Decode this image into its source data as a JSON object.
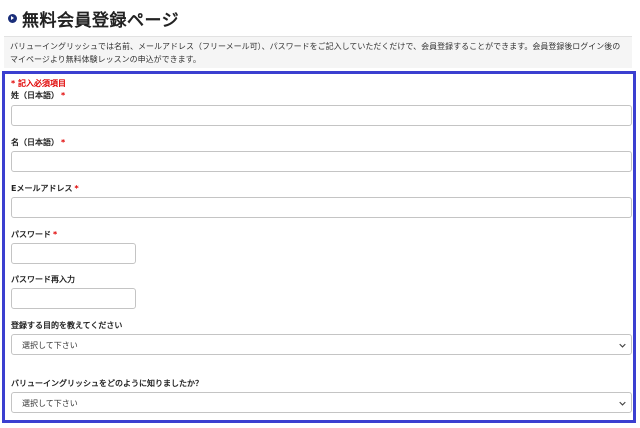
{
  "page": {
    "title": "無料会員登録ページ",
    "intro": "バリューイングリッシュでは名前、メールアドレス（フリーメール可）、パスワードをご記入していただくだけで、会員登録することができます。会員登録後ログイン後のマイページより無料体験レッスンの申込ができます。"
  },
  "form": {
    "required_note": "* 記入必須項目",
    "required_mark": "*",
    "fields": {
      "last_name": {
        "label": "姓（日本語）",
        "value": ""
      },
      "first_name": {
        "label": "名（日本語）",
        "value": ""
      },
      "email": {
        "label": "Eメールアドレス",
        "value": ""
      },
      "password": {
        "label": "パスワード",
        "value": ""
      },
      "password_confirm": {
        "label": "パスワード再入力",
        "value": ""
      },
      "purpose": {
        "label": "登録する目的を教えてください",
        "selected": "選択して下さい"
      },
      "referral": {
        "label": "バリューイングリッシュをどのように知りましたか？",
        "selected": "選択して下さい"
      }
    }
  },
  "icons": {
    "title_bullet": "circle-arrow-icon",
    "select_arrow": "chevron-down-icon"
  },
  "colors": {
    "accent_border": "#3b3fd0",
    "required": "#e00000",
    "bullet": "#1a2e7a"
  }
}
